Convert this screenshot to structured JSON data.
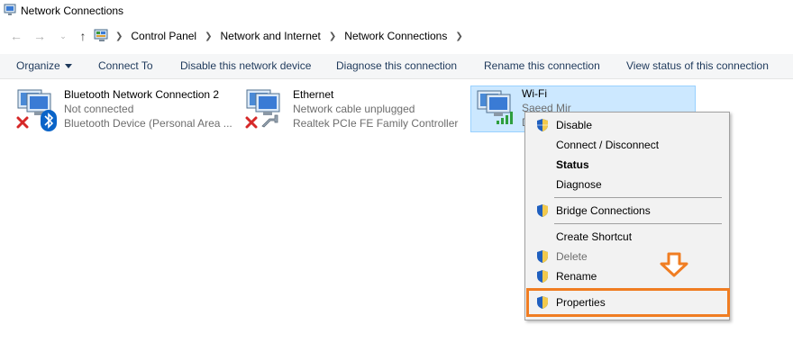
{
  "window": {
    "title": "Network Connections",
    "app_icon": "network-connections-icon"
  },
  "address": {
    "back_icon": "back-arrow-icon",
    "forward_icon": "forward-arrow-icon",
    "dropdown_icon": "recent-locations-chevron-icon",
    "up_icon": "up-arrow-icon",
    "crumbs": [
      "Control Panel",
      "Network and Internet",
      "Network Connections"
    ]
  },
  "toolbar": {
    "organize": "Organize",
    "connect_to": "Connect To",
    "disable": "Disable this network device",
    "diagnose": "Diagnose this connection",
    "rename": "Rename this connection",
    "view_status": "View status of this connection"
  },
  "connections": [
    {
      "name": "Bluetooth Network Connection 2",
      "status": "Not connected",
      "device": "Bluetooth Device (Personal Area ...",
      "status_icon": "red-x-icon",
      "badge_icon": "bluetooth-icon"
    },
    {
      "name": "Ethernet",
      "status": "Network cable unplugged",
      "device": "Realtek PCIe FE Family Controller",
      "status_icon": "red-x-icon",
      "badge_icon": "network-cable-icon"
    },
    {
      "name": "Wi-Fi",
      "status": "Saeed Mir",
      "device": "D",
      "badge_icon": "signal-bars-icon",
      "selected": true
    }
  ],
  "context_menu": {
    "items": [
      {
        "label": "Disable",
        "shield": true
      },
      {
        "label": "Connect / Disconnect",
        "shield": false
      },
      {
        "label": "Status",
        "shield": false,
        "bold": true
      },
      {
        "label": "Diagnose",
        "shield": false
      },
      {
        "label": "Bridge Connections",
        "shield": true
      },
      {
        "label": "Create Shortcut",
        "shield": false
      },
      {
        "label": "Delete",
        "shield": true,
        "disabled": true
      },
      {
        "label": "Rename",
        "shield": true
      },
      {
        "label": "Properties",
        "shield": true,
        "highlighted": true
      }
    ]
  },
  "annotation": {
    "highlight_color": "#f07d22",
    "arrow_icon": "down-arrow-icon"
  },
  "colors": {
    "selection_bg": "#cce8ff",
    "selection_border": "#99d1ff",
    "toolbar_text": "#1e395b",
    "uac_shield_blue": "#1f5fbf",
    "uac_shield_yellow": "#f2c94c"
  }
}
